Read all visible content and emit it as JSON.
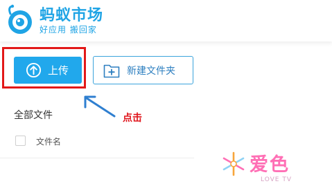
{
  "header": {
    "logo_title": "蚂蚁市场",
    "logo_subtitle": "好应用 搬回家",
    "logo_icon": "ant-eye-icon"
  },
  "toolbar": {
    "upload_label": "上传",
    "upload_icon": "upload-arrow-icon",
    "new_folder_label": "新建文件夹",
    "new_folder_icon": "folder-plus-icon"
  },
  "annotation": {
    "click_hint": "点击",
    "highlight_color": "#e21818",
    "arrow_color": "#2f7fd0"
  },
  "file_list": {
    "section_title": "全部文件",
    "columns": [
      "文件名"
    ]
  },
  "watermark": {
    "text": "爱色",
    "subtitle": "LOVE TV"
  },
  "colors": {
    "brand": "#1fa4e5",
    "upload_button": "#21a8ec",
    "hint_red": "#e0141b"
  }
}
